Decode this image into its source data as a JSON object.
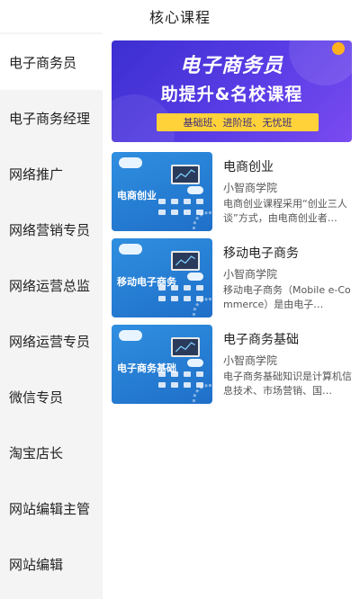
{
  "header": {
    "title": "核心课程"
  },
  "sidebar": {
    "items": [
      {
        "label": "电子商务员",
        "active": true
      },
      {
        "label": "电子商务经理",
        "active": false
      },
      {
        "label": "网络推广",
        "active": false
      },
      {
        "label": "网络营销专员",
        "active": false
      },
      {
        "label": "网络运营总监",
        "active": false
      },
      {
        "label": "网络运营专员",
        "active": false
      },
      {
        "label": "微信专员",
        "active": false
      },
      {
        "label": "淘宝店长",
        "active": false
      },
      {
        "label": "网站编辑主管",
        "active": false
      },
      {
        "label": "网站编辑",
        "active": false
      }
    ]
  },
  "banner": {
    "title": "电子商务员",
    "subtitle": "助提升&名校课程",
    "tag": "基础班、进阶班、无忧班"
  },
  "courses": [
    {
      "thumb_label": "电商创业",
      "title": "电商创业",
      "school": "小智商学院",
      "description": "电商创业课程采用“创业三人谈”方式，由电商创业者…"
    },
    {
      "thumb_label": "移动电子商务",
      "title": "移动电子商务",
      "school": "小智商学院",
      "description": "移动电子商务（Mobile e-Commerce）是由电子…"
    },
    {
      "thumb_label": "电子商务基础",
      "title": "电子商务基础",
      "school": "小智商学院",
      "description": "电子商务基础知识是计算机信息技术、市场营销、国…"
    }
  ],
  "colors": {
    "banner_bg": "#4a36dc",
    "banner_tag_bg": "#ffd23a",
    "thumb_bg": "#2a80d8",
    "sidebar_bg": "#f4f4f4"
  }
}
